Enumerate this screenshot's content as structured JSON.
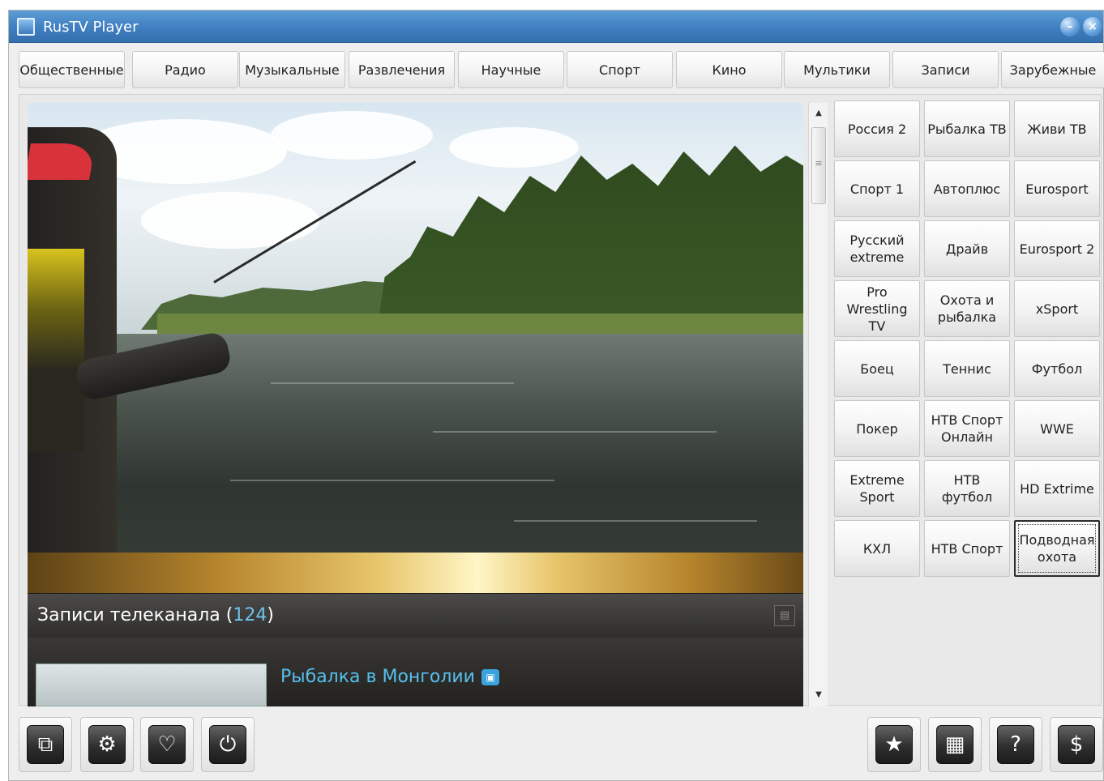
{
  "window": {
    "title": "RusTV Player"
  },
  "tabs": [
    "Общественные",
    "Радио",
    "Музыкальные",
    "Развлечения",
    "Научные",
    "Спорт",
    "Кино",
    "Мультики",
    "Записи",
    "Зарубежные"
  ],
  "channels": [
    "Россия 2",
    "Рыбалка ТВ",
    "Живи ТВ",
    "Спорт 1",
    "Автоплюс",
    "Eurosport",
    "Русский extreme",
    "Драйв",
    "Eurosport 2",
    "Pro Wrestling TV",
    "Охота и рыбалка",
    "xSport",
    "Боец",
    "Теннис",
    "Футбол",
    "Покер",
    "НТВ Спорт Онлайн",
    "WWE",
    "Extreme Sport",
    "НТВ футбол",
    "HD Extrime",
    "КХЛ",
    "НТВ Спорт",
    "Подводная охота"
  ],
  "selected_channel": "Подводная охота",
  "records": {
    "header_label": "Записи телеканала",
    "count": "124",
    "items": [
      {
        "title": "Рыбалка в Монголии"
      }
    ]
  },
  "bottom_left_buttons": [
    {
      "name": "popout",
      "icon": "external-window-icon"
    },
    {
      "name": "settings",
      "icon": "gear-icon"
    },
    {
      "name": "favorites",
      "icon": "heart-icon"
    },
    {
      "name": "power",
      "icon": "power-icon"
    }
  ],
  "bottom_right_buttons": [
    {
      "name": "star",
      "icon": "star-icon"
    },
    {
      "name": "grid",
      "icon": "grid-icon"
    },
    {
      "name": "help",
      "icon": "help-icon"
    },
    {
      "name": "donate",
      "icon": "dollar-icon"
    }
  ]
}
